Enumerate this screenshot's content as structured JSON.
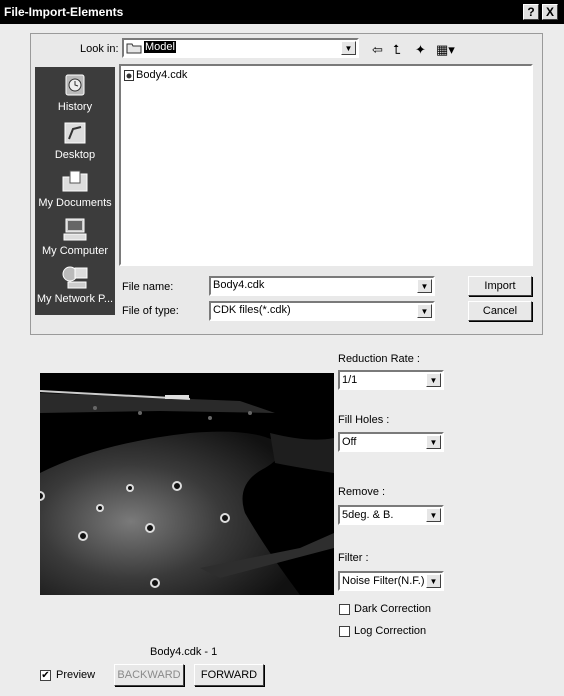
{
  "window": {
    "title": "File-Import-Elements",
    "help_button": "?",
    "close_button": "X"
  },
  "dialog": {
    "look_in_label": "Look in:",
    "look_in_value": "Model",
    "files": [
      {
        "name": "Body4.cdk"
      }
    ],
    "places": [
      {
        "label": "History",
        "icon": "history-icon"
      },
      {
        "label": "Desktop",
        "icon": "desktop-icon"
      },
      {
        "label": "My Documents",
        "icon": "documents-folder-icon"
      },
      {
        "label": "My Computer",
        "icon": "computer-icon"
      },
      {
        "label": "My Network P...",
        "icon": "network-icon"
      }
    ],
    "file_name_label": "File name:",
    "file_name_value": "Body4.cdk",
    "file_type_label": "File of type:",
    "file_type_value": "CDK files(*.cdk)",
    "import_button": "Import",
    "cancel_button": "Cancel"
  },
  "options": {
    "reduction_rate_label": "Reduction Rate :",
    "reduction_rate_value": "1/1",
    "fill_holes_label": "Fill Holes :",
    "fill_holes_value": "Off",
    "remove_label": "Remove :",
    "remove_value": "5deg. & B.",
    "filter_label": "Filter :",
    "filter_value": "Noise Filter(N.F.)",
    "dark_correction_label": "Dark Correction",
    "dark_correction_checked": false,
    "log_correction_label": "Log Correction",
    "log_correction_checked": false
  },
  "preview": {
    "caption": "Body4.cdk - 1",
    "preview_label": "Preview",
    "preview_checked": true,
    "backward_button": "BACKWARD",
    "forward_button": "FORWARD"
  }
}
